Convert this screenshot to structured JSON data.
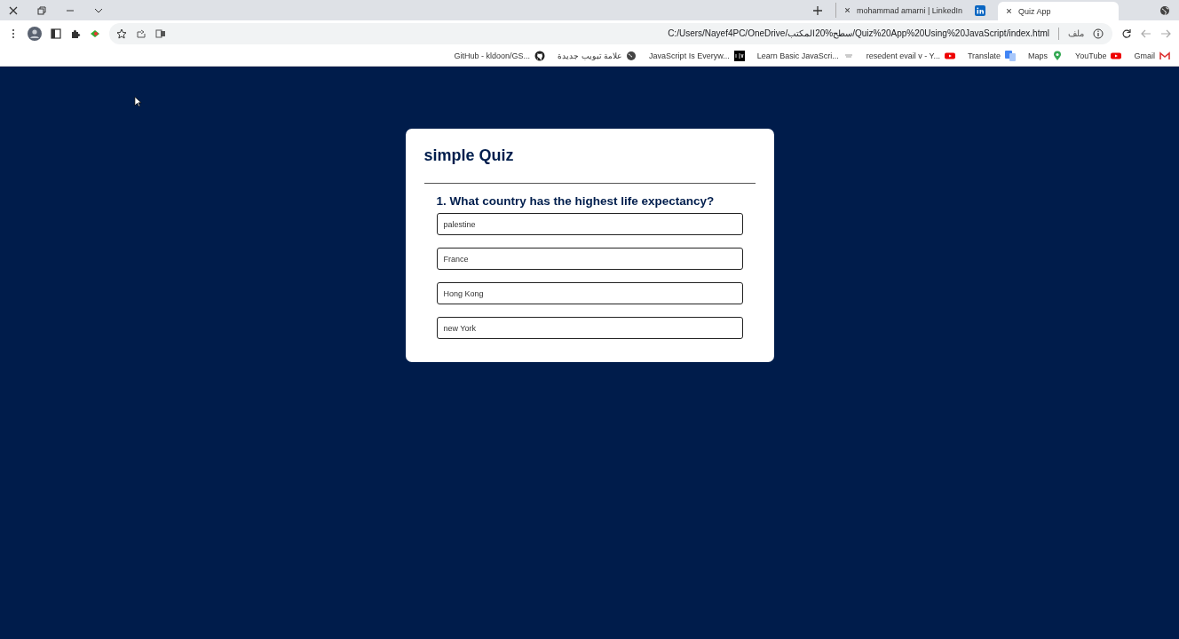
{
  "tabs": [
    {
      "label": "mohammad amarni | LinkedIn",
      "selected": false
    },
    {
      "label": "Quiz App",
      "selected": true
    }
  ],
  "address_bar": {
    "scheme_label": "ملف",
    "url": "C:/Users/Nayef4PC/OneDrive/سطح%20المكتب/Quiz%20App%20Using%20JavaScript/index.html"
  },
  "bookmarks": [
    {
      "label": "GitHub - kldoon/GS...",
      "kind": "github"
    },
    {
      "label": "علامة تبويب جديدة",
      "kind": "globe"
    },
    {
      "label": "JavaScript Is Everyw...",
      "kind": "dev"
    },
    {
      "label": "Learn Basic JavaScri...",
      "kind": "doc"
    },
    {
      "label": "resedent evail v - Y...",
      "kind": "youtube"
    },
    {
      "label": "Translate",
      "kind": "translate"
    },
    {
      "label": "Maps",
      "kind": "maps"
    },
    {
      "label": "YouTube",
      "kind": "youtube"
    },
    {
      "label": "Gmail",
      "kind": "gmail"
    }
  ],
  "quiz": {
    "title": "simple Quiz",
    "question": "1. What country has the highest life expectancy?",
    "answers": [
      "palestine",
      "France",
      "Hong Kong",
      "new York"
    ]
  }
}
